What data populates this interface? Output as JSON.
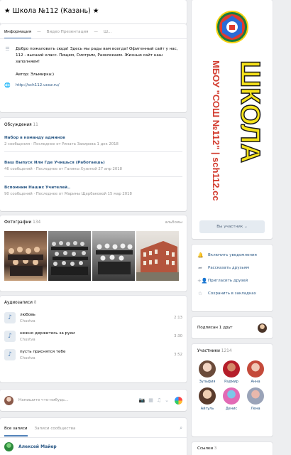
{
  "header": {
    "title": "★ Школа №112 (Казань) ★"
  },
  "info": {
    "tabs": [
      "Информация",
      "Видео Презентация",
      "Ш..."
    ],
    "welcome": "Добро пожаловать сюда! Здесь мы рады вам всегда! Офигенный сайт у нас, 112 - высший класс. Пищем, Смотрим, Развлекаем. Жизнью сайт наш заполняем!",
    "author": "Автор: Эльмирка:)",
    "site": "http://sch112.ucoz.ru/"
  },
  "discussions": {
    "label": "Обсуждения",
    "count": "11",
    "items": [
      {
        "title": "Набор в команду админов",
        "meta": "2 сообщения · Последнее от Рината Закирова 1 дек 2018"
      },
      {
        "title": "Ваш Выпуск Или Где Учишься (Работаешь)",
        "meta": "46 сообщений · Последнее от Галины Хузиной 27 апр 2018"
      },
      {
        "title": "Вспомним Наших Учителей..",
        "meta": "90 сообщений · Последнее от Марины Щербаковой 15 мар 2018"
      }
    ]
  },
  "photos": {
    "label": "Фотографии",
    "count": "134",
    "albums_link": "альбомы"
  },
  "audio": {
    "label": "Аудиозаписи",
    "count": "8",
    "tracks": [
      {
        "title": "любовь",
        "artist": "Chustva",
        "duration": "2:13"
      },
      {
        "title": "нежно держитесь за руки",
        "artist": "Chustva",
        "duration": "3:30"
      },
      {
        "title": "пусть приснятся тебе",
        "artist": "Chustva",
        "duration": "3:52"
      }
    ]
  },
  "composer": {
    "placeholder": "Напишите что-нибудь..."
  },
  "posts": {
    "tabs": [
      "Все записи",
      "Записи сообщества"
    ],
    "first_author": "Алексей Майер"
  },
  "cover": {
    "vertical_text": "ШКОЛА",
    "vertical_sub": "МБОУ \"СОШ №112\" | sch112.cc"
  },
  "members_button": "Вы участник",
  "actions": [
    {
      "icon": "bell-icon",
      "glyph": "🔔",
      "label": "Включить уведомления"
    },
    {
      "icon": "share-icon",
      "glyph": "➦",
      "label": "Рассказать друзьям"
    },
    {
      "icon": "invite-icon",
      "glyph": "+👤",
      "label": "Пригласить друзей"
    },
    {
      "icon": "star-icon",
      "glyph": "☆",
      "label": "Сохранить в закладках"
    }
  ],
  "subscribed": {
    "text": "Подписан 1 друг"
  },
  "members": {
    "label": "Участники",
    "count": "1214",
    "people": [
      "Зульфия",
      "Радмир",
      "Анна",
      "Айгуль",
      "Денис",
      "Лена"
    ]
  },
  "links": {
    "label": "Ссылки",
    "count": "3"
  },
  "colors": {
    "accent": "#5181b8",
    "link": "#2a5885",
    "muted": "#939393",
    "page_bg": "#edeef0"
  }
}
